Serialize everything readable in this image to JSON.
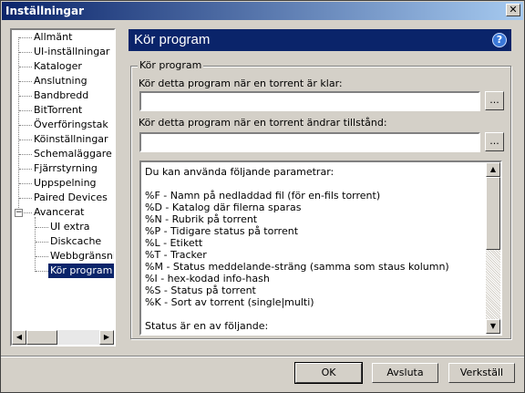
{
  "window": {
    "title": "Inställningar",
    "close_glyph": "✕"
  },
  "tree": {
    "items": [
      {
        "label": "Allmänt"
      },
      {
        "label": "UI-inställningar"
      },
      {
        "label": "Kataloger"
      },
      {
        "label": "Anslutning"
      },
      {
        "label": "Bandbredd"
      },
      {
        "label": "BitTorrent"
      },
      {
        "label": "Överföringstak"
      },
      {
        "label": "Köinställningar"
      },
      {
        "label": "Schemaläggare"
      },
      {
        "label": "Fjärrstyrning"
      },
      {
        "label": "Uppspelning"
      },
      {
        "label": "Paired Devices"
      },
      {
        "label": "Avancerat",
        "expander": "−"
      }
    ],
    "children": [
      {
        "label": "UI extra"
      },
      {
        "label": "Diskcache"
      },
      {
        "label": "Webbgränsnit"
      },
      {
        "label": "Kör program",
        "selected": true
      }
    ],
    "scroll_left": "◀",
    "scroll_right": "▶"
  },
  "header": {
    "title": "Kör program",
    "help": "?"
  },
  "group": {
    "legend": "Kör program",
    "field1_label": "Kör detta program när en torrent är klar:",
    "field1_value": "",
    "field2_label": "Kör detta program när en torrent ändrar tillstånd:",
    "field2_value": "",
    "browse_label": "...",
    "info_lines": [
      "Du kan använda följande parametrar:",
      "",
      "%F - Namn på nedladdad fil (för en-fils torrent)",
      "%D - Katalog där filerna sparas",
      "%N - Rubrik på torrent",
      "%P - Tidigare status på torrent",
      "%L - Etikett",
      "%T - Tracker",
      "%M - Status meddelande-sträng (samma som staus kolumn)",
      "%I - hex-kodad info-hash",
      "%S - Status på torrent",
      "%K - Sort av torrent (single|multi)",
      "",
      "Status är en av följande:"
    ],
    "scroll_up": "▲",
    "scroll_down": "▼"
  },
  "buttons": {
    "ok": "OK",
    "cancel": "Avsluta",
    "apply": "Verkställ"
  },
  "colors": {
    "header_bg": "#0a246a",
    "selection_bg": "#0a246a",
    "face": "#d4d0c8"
  }
}
